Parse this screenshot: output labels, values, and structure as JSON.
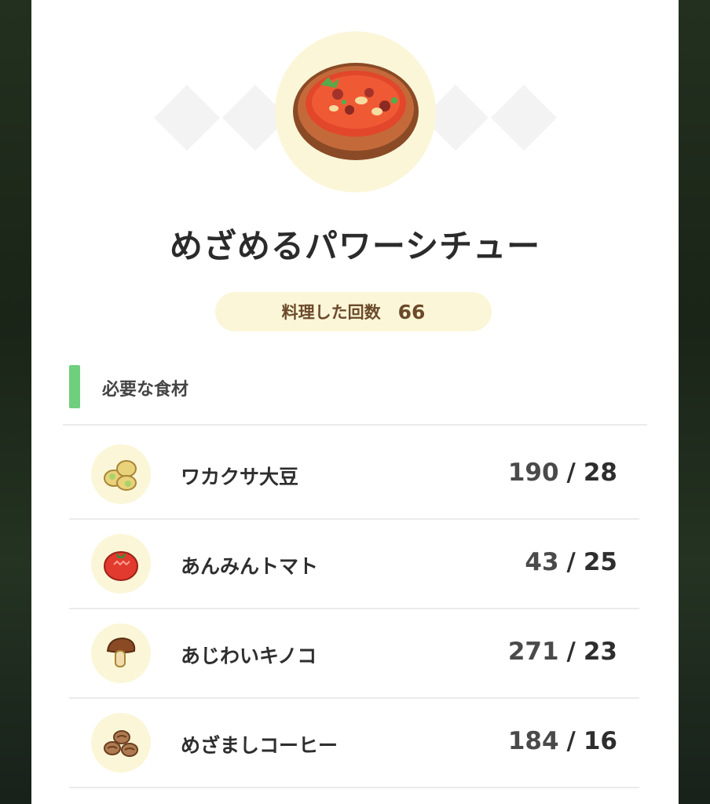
{
  "recipe": {
    "name": "めざめるパワーシチュー",
    "cooked_label": "料理した回数",
    "cooked_count": "66"
  },
  "ingredients_section": {
    "title": "必要な食材",
    "accent_color": "#6fcf7e",
    "items": [
      {
        "name": "ワカクサ大豆",
        "have": "190",
        "separator": "/",
        "need": "28",
        "icon": "soybean-icon"
      },
      {
        "name": "あんみんトマト",
        "have": "43",
        "separator": "/",
        "need": "25",
        "icon": "tomato-icon"
      },
      {
        "name": "あじわいキノコ",
        "have": "271",
        "separator": "/",
        "need": "23",
        "icon": "mushroom-icon"
      },
      {
        "name": "めざましコーヒー",
        "have": "184",
        "separator": "/",
        "need": "16",
        "icon": "coffee-bean-icon"
      }
    ]
  },
  "colors": {
    "card_bg": "#ffffff",
    "pill_bg": "#fbf6d8",
    "pill_text": "#6b4a2a",
    "page_bg": "#1f2a1d"
  }
}
